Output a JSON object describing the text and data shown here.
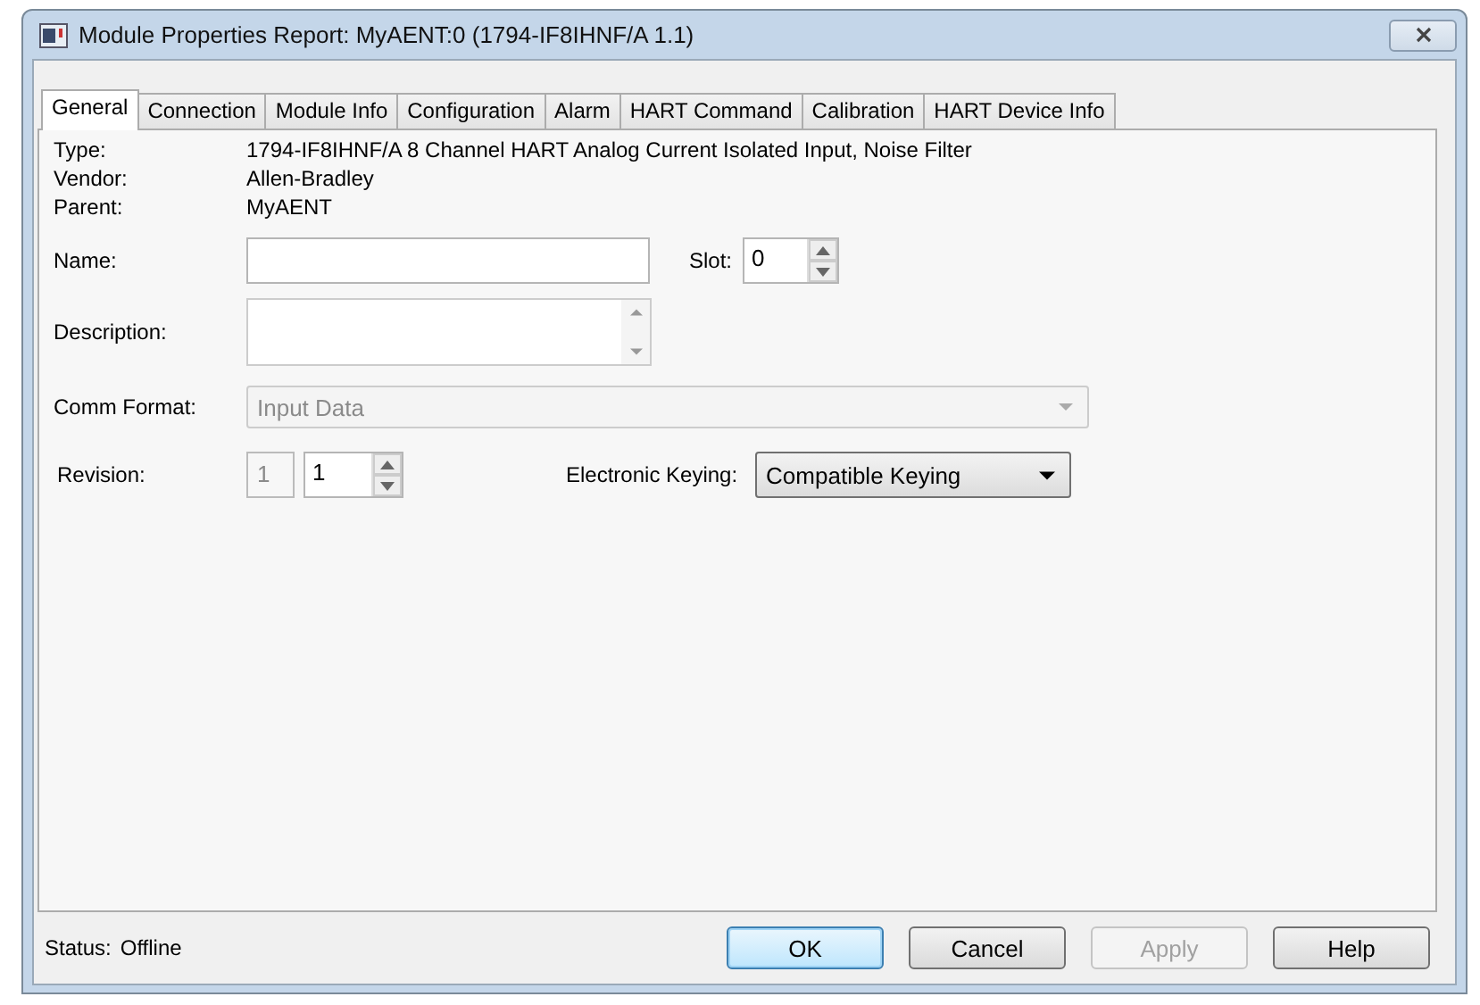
{
  "window": {
    "title": "Module Properties Report: MyAENT:0 (1794-IF8IHNF/A 1.1)"
  },
  "tabs": [
    {
      "label": "General",
      "selected": true
    },
    {
      "label": "Connection",
      "selected": false
    },
    {
      "label": "Module Info",
      "selected": false
    },
    {
      "label": "Configuration",
      "selected": false
    },
    {
      "label": "Alarm",
      "selected": false
    },
    {
      "label": "HART Command",
      "selected": false
    },
    {
      "label": "Calibration",
      "selected": false
    },
    {
      "label": "HART Device Info",
      "selected": false
    }
  ],
  "info": [
    {
      "label": "Type:",
      "value": "1794-IF8IHNF/A 8 Channel HART Analog Current Isolated Input, Noise Filter"
    },
    {
      "label": "Vendor:",
      "value": "Allen-Bradley"
    },
    {
      "label": "Parent:",
      "value": "MyAENT"
    }
  ],
  "name": {
    "label": "Name:"
  },
  "slot": {
    "label": "Slot:",
    "value": "0"
  },
  "description": {
    "label": "Description:"
  },
  "comm_format": {
    "label": "Comm Format:",
    "value": "Input Data",
    "disabled": true
  },
  "revision": {
    "label": "Revision:",
    "major": "1",
    "minor": "1"
  },
  "electronic_keying": {
    "label": "Electronic Keying:",
    "value": "Compatible Keying",
    "disabled": false
  },
  "status": {
    "label": "Status:",
    "value": "Offline"
  },
  "buttons": [
    {
      "label": "OK",
      "default": true,
      "disabled": false
    },
    {
      "label": "Cancel",
      "default": false,
      "disabled": false
    },
    {
      "label": "Apply",
      "default": false,
      "disabled": true
    },
    {
      "label": "Help",
      "default": false,
      "disabled": false
    }
  ]
}
